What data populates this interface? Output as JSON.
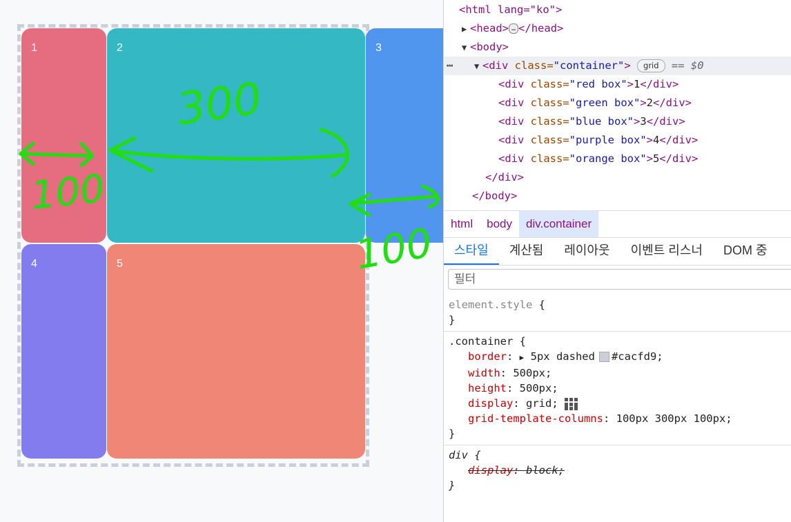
{
  "boxes": [
    "1",
    "2",
    "3",
    "4",
    "5"
  ],
  "annotations": {
    "label_300": "300",
    "label_100_left": "100",
    "label_100_right": "100"
  },
  "elements": {
    "html_open": "<html lang=\"ko\">",
    "head": {
      "open": "<head>",
      "ellipsis": "…",
      "close": "</head>"
    },
    "body_open": "<body>",
    "container_div": {
      "tag_open": "<div ",
      "attr": "class=",
      "val": "\"container\"",
      "tag_close": ">",
      "badge": "grid",
      "eq": "== $0"
    },
    "children": [
      {
        "attr_val": "\"red box\"",
        "text": "1"
      },
      {
        "attr_val": "\"green box\"",
        "text": "2"
      },
      {
        "attr_val": "\"blue box\"",
        "text": "3"
      },
      {
        "attr_val": "\"purple box\"",
        "text": "4"
      },
      {
        "attr_val": "\"orange box\"",
        "text": "5"
      }
    ],
    "div_close": "</div>",
    "body_close": "</body>"
  },
  "breadcrumbs": [
    "html",
    "body",
    "div.container"
  ],
  "tabs": [
    "스타일",
    "계산됨",
    "레이아웃",
    "이벤트 리스너",
    "DOM 중"
  ],
  "filter_placeholder": "필터",
  "styles": {
    "element_style": {
      "selector": "element.style",
      "open": " {",
      "close": "}"
    },
    "container_rule": {
      "selector": ".container",
      "open": " {",
      "border_prop": "border",
      "border_val": "5px dashed",
      "border_color": "#cacfd9",
      "width_prop": "width",
      "width_val": "500px;",
      "height_prop": "height",
      "height_val": "500px;",
      "display_prop": "display",
      "display_val": "grid;",
      "gtc_prop": "grid-template-columns",
      "gtc_val": "100px 300px 100px;",
      "close": "}"
    },
    "div_rule": {
      "selector": "div",
      "open": " {",
      "display_prop": "display",
      "display_val": "block;",
      "close": "}"
    }
  },
  "colors": {
    "red": "#e66d80",
    "green": "#33b8c4",
    "blue": "#5096ee",
    "purple": "#837cee",
    "orange": "#f08676",
    "annotation": "#22dd11"
  }
}
